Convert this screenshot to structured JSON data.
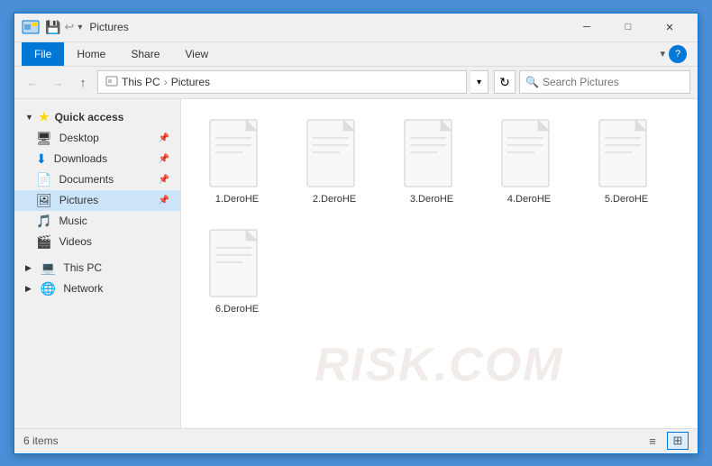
{
  "window": {
    "title": "Pictures",
    "icon": "📁"
  },
  "titlebar": {
    "quick_access_arrow": "▼",
    "controls": {
      "minimize": "─",
      "maximize": "□",
      "close": "✕"
    }
  },
  "ribbon": {
    "tabs": [
      "File",
      "Home",
      "Share",
      "View"
    ],
    "active_tab": "File",
    "help_icon": "?"
  },
  "address_bar": {
    "back": "←",
    "forward": "→",
    "up": "↑",
    "path": [
      "This PC",
      "Pictures"
    ],
    "dropdown": "▾",
    "refresh": "↻",
    "search_placeholder": "Search Pictures"
  },
  "sidebar": {
    "sections": [
      {
        "label": "Quick access",
        "icon": "★",
        "items": [
          {
            "label": "Desktop",
            "icon": "🖥",
            "pinned": true
          },
          {
            "label": "Downloads",
            "icon": "⬇",
            "pinned": true
          },
          {
            "label": "Documents",
            "icon": "📄",
            "pinned": true
          },
          {
            "label": "Pictures",
            "icon": "🖼",
            "pinned": true,
            "active": true
          }
        ]
      },
      {
        "label": "",
        "items": [
          {
            "label": "Music",
            "icon": "♪",
            "pinned": false
          },
          {
            "label": "Videos",
            "icon": "🎬",
            "pinned": false
          }
        ]
      },
      {
        "label": "This PC",
        "icon": "💻",
        "items": []
      },
      {
        "label": "Network",
        "icon": "🌐",
        "items": []
      }
    ]
  },
  "files": [
    {
      "name": "1.DeroHE"
    },
    {
      "name": "2.DeroHE"
    },
    {
      "name": "3.DeroHE"
    },
    {
      "name": "4.DeroHE"
    },
    {
      "name": "5.DeroHE"
    },
    {
      "name": "6.DeroHE"
    }
  ],
  "status_bar": {
    "count": "6 items"
  },
  "watermark": "RISK.COM"
}
